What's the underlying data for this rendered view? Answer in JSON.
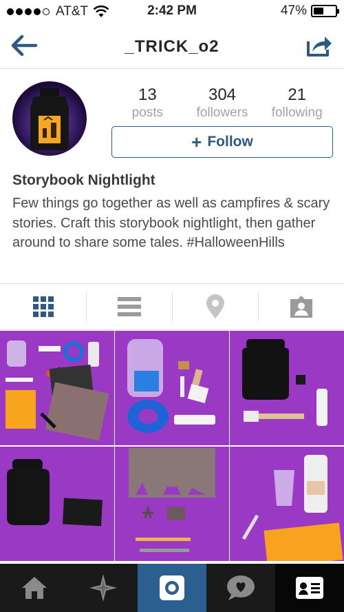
{
  "status_bar": {
    "carrier": "AT&T",
    "time": "2:42 PM",
    "battery": "47%",
    "battery_level": 0.47
  },
  "nav": {
    "title": "_TRICK_o2",
    "back_icon": "back-arrow-icon",
    "share_icon": "share-icon"
  },
  "profile": {
    "stats": [
      {
        "value": "13",
        "label": "posts"
      },
      {
        "value": "304",
        "label": "followers"
      },
      {
        "value": "21",
        "label": "following"
      }
    ],
    "follow_label": "Follow",
    "name": "Storybook Nightlight",
    "bio": "Few things go together as well as campfires & scary stories. Craft this storybook nightlight, then gather around to share some tales. #HalloweenHills"
  },
  "view_tabs": [
    {
      "icon": "grid-view-icon",
      "active": true
    },
    {
      "icon": "list-view-icon",
      "active": false
    },
    {
      "icon": "location-pin-icon",
      "active": false
    },
    {
      "icon": "tagged-photos-icon",
      "active": false
    }
  ],
  "posts": [
    {
      "subject": "craft supplies flat lay"
    },
    {
      "subject": "glass jar with tape and brush"
    },
    {
      "subject": "black painted jar with supplies"
    },
    {
      "subject": "black jar and felt square"
    },
    {
      "subject": "cut paper silhouette template"
    },
    {
      "subject": "glass and spray paint"
    }
  ],
  "tab_bar": [
    {
      "icon": "home-icon",
      "active": false
    },
    {
      "icon": "explore-icon",
      "active": false
    },
    {
      "icon": "camera-icon",
      "active": true
    },
    {
      "icon": "activity-icon",
      "active": false
    },
    {
      "icon": "profile-icon",
      "active": false
    }
  ],
  "colors": {
    "accent": "#2c5a85",
    "photo_background": "#9a39c4",
    "tab_bar": "#1a1a1a",
    "tab_bar_active": "#2a5f8f"
  }
}
